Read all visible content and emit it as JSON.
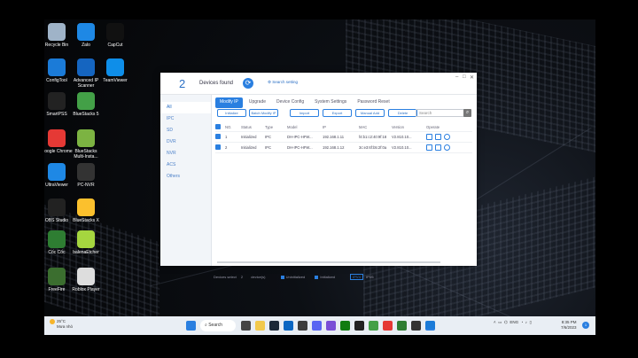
{
  "desktop_icons": [
    {
      "label": "Recycle Bin",
      "icon": "recycle-bin-icon",
      "color": "#9fb3c8"
    },
    {
      "label": "Zalo",
      "icon": "zalo-icon",
      "color": "#1e88e5"
    },
    {
      "label": "CapCut",
      "icon": "capcut-icon",
      "color": "#111111"
    },
    {
      "label": "ConfigTool",
      "icon": "configtool-icon",
      "color": "#1b7bd8"
    },
    {
      "label": "Advanced IP Scanner",
      "icon": "advanced-ip-scanner-icon",
      "color": "#1565c0"
    },
    {
      "label": "TeamViewer",
      "icon": "teamviewer-icon",
      "color": "#0e8ee9"
    },
    {
      "label": "SmartPSS",
      "icon": "smartpss-icon",
      "color": "#222222"
    },
    {
      "label": "BlueStacks 5",
      "icon": "bluestacks-icon",
      "color": "#43a047"
    },
    {
      "label": "Google Chrome",
      "icon": "chrome-icon",
      "color": "#e53935"
    },
    {
      "label": "BlueStacks Multi-Insta...",
      "icon": "bluestacks-multi-icon",
      "color": "#7cb342"
    },
    {
      "label": "UltraViewer",
      "icon": "ultraviewer-icon",
      "color": "#1e88e5"
    },
    {
      "label": "PC-NVR",
      "icon": "pc-nvr-icon",
      "color": "#333333"
    },
    {
      "label": "OBS Studio",
      "icon": "obs-icon",
      "color": "#222222"
    },
    {
      "label": "BlueStacks X",
      "icon": "bluestacks-x-icon",
      "color": "#fbc02d"
    },
    {
      "label": "Cốc Cốc",
      "icon": "coccoc-icon",
      "color": "#2e7d32"
    },
    {
      "label": "balenaEtcher",
      "icon": "balenaetcher-icon",
      "color": "#a5d63f"
    },
    {
      "label": "FreeFire",
      "icon": "freefire-icon",
      "color": "#3b6e2f"
    },
    {
      "label": "Roblox Player",
      "icon": "roblox-icon",
      "color": "#dddddd"
    }
  ],
  "app": {
    "device_count": "2",
    "devices_found": "Devices found",
    "search_setting": "Search setting",
    "window_controls": [
      "–",
      "□",
      "✕"
    ],
    "sidebar": [
      "All",
      "IPC",
      "SD",
      "DVR",
      "NVR",
      "ACS",
      "Others"
    ],
    "tabs": [
      "Modify IP",
      "Upgrade",
      "Device Config",
      "System Settings",
      "Password Reset"
    ],
    "toolbar": [
      "Initialize",
      "Batch Modify IP",
      "Import",
      "Export",
      "Manual Add",
      "Delete"
    ],
    "search_placeholder": "Search",
    "table": {
      "headers": [
        "",
        "NO.",
        "Status",
        "Type",
        "Model",
        "IP",
        "MAC",
        "Version",
        "Operate"
      ],
      "rows": [
        {
          "no": "1",
          "status": "Initialized",
          "type": "IPC",
          "model": "DH-IPC-HFW...",
          "ip": "192.168.1.11",
          "mac": "f4:b1:c2:40:9f:18",
          "version": "V2.810.10..."
        },
        {
          "no": "2",
          "status": "Initialized",
          "type": "IPC",
          "model": "DH-IPC-HFW...",
          "ip": "192.168.1.12",
          "mac": "3c:e3:6f:b5:2f:0a",
          "version": "V2.810.10..."
        }
      ]
    },
    "footer": {
      "devices_select": "Devices select",
      "select_count": "2",
      "devices_total": "device(s)",
      "uninitialized": "Uninitialized",
      "initialized": "Initialized",
      "ipv4": "IPV4",
      "ipv6": "IPV6"
    }
  },
  "taskbar": {
    "temperature": "25°C",
    "weather": "Mưa nhỏ",
    "search_label": "Search",
    "tray_lang": "ENG",
    "time": "8:35 PM",
    "date": "7/6/2023",
    "notifications": "1"
  }
}
